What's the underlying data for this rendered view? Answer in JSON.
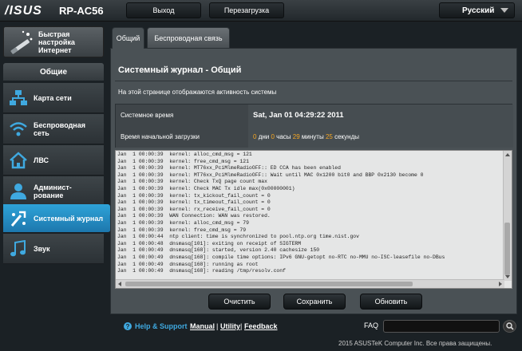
{
  "header": {
    "brand": "/ISUS",
    "model": "RP-AC56",
    "logout_label": "Выход",
    "reboot_label": "Перезагрузка",
    "language": "Русский"
  },
  "sidebar": {
    "quick_setup_label": "Быстрая\nнастройка\nИнтернет",
    "section_label": "Общие",
    "items": [
      {
        "label": "Карта сети",
        "icon": "network-map-icon"
      },
      {
        "label": "Беспроводная\nсеть",
        "icon": "wireless-icon"
      },
      {
        "label": "ЛВС",
        "icon": "home-lan-icon"
      },
      {
        "label": "Админист-\nрование",
        "icon": "admin-icon"
      },
      {
        "label": "Системный журнал",
        "icon": "system-log-icon",
        "active": true
      },
      {
        "label": "Звук",
        "icon": "music-icon"
      }
    ]
  },
  "tabs": [
    {
      "label": "Общий",
      "active": true
    },
    {
      "label": "Беспроводная связь",
      "active": false
    }
  ],
  "main": {
    "title": "Системный журнал - Общий",
    "description": "На этой странице отображаются активность системы",
    "system_time_label": "Системное время",
    "system_time_value": "Sat, Jan 01  04:29:22  2011",
    "uptime_label": "Время начальной загрузки",
    "uptime": {
      "days": "0",
      "days_unit": "дни",
      "hours": "0",
      "hours_unit": "часы",
      "minutes": "29",
      "minutes_unit": "минуты",
      "seconds": "25",
      "seconds_unit": "секунды"
    }
  },
  "log_lines": [
    "Jan  1 00:00:39  kernel: alloc_cmd_msg = 121",
    "Jan  1 00:00:39  kernel: free_cmd_msg = 121",
    "Jan  1 00:00:39  kernel: MT76xx_PciMlmeRadioOFF:: ED CCA has been enabled",
    "Jan  1 00:00:39  kernel: MT76xx_PciMlmeRadioOFF:: Wait until MAC 0x1200 bit0 and BBP 0x2130 become 0",
    "Jan  1 00:00:39  kernel: Check TxQ page count max",
    "Jan  1 00:00:39  kernel: Check MAC Tx idle max(0x00000001)",
    "Jan  1 00:00:39  kernel: tx_kickout_fail_count = 0",
    "Jan  1 00:00:39  kernel: tx_timeout_fail_count = 0",
    "Jan  1 00:00:39  kernel: rx_receive_fail_count = 0",
    "Jan  1 00:00:39  WAN Connection: WAN was restored.",
    "Jan  1 00:00:39  kernel: alloc_cmd_msg = 79",
    "Jan  1 00:00:39  kernel: free_cmd_msg = 79",
    "Jan  1 00:00:44  ntp client: time is synchronized to pool.ntp.org time.nist.gov",
    "Jan  1 00:00:48  dnsmasq[101]: exiting on receipt of SIGTERM",
    "Jan  1 00:00:49  dnsmasq[168]: started, version 2.40 cachesize 150",
    "Jan  1 00:00:49  dnsmasq[168]: compile time options: IPv6 GNU-getopt no-RTC no-MMU no-ISC-leasefile no-DBus",
    "Jan  1 00:00:49  dnsmasq[168]: running as root",
    "Jan  1 00:00:49  dnsmasq[168]: reading /tmp/resolv.conf"
  ],
  "actions": {
    "clear_label": "Очистить",
    "save_label": "Сохранить",
    "refresh_label": "Обновить"
  },
  "footer": {
    "help_label": "Help & Support",
    "manual_label": "Manual",
    "utility_label": "Utility",
    "feedback_label": "Feedback",
    "faq_label": "FAQ",
    "copyright": "2015 ASUSTeK Computer Inc. Все права защищены."
  },
  "colors": {
    "accent": "#1f86c1",
    "highlight": "#f5a623",
    "background": "#1b2125"
  }
}
